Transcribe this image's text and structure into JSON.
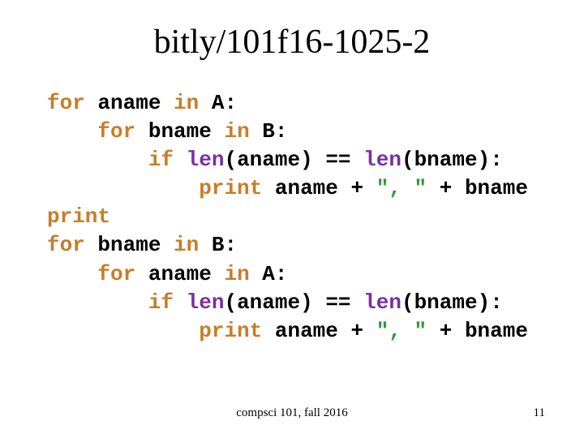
{
  "title": "bitly/101f16-1025-2",
  "footer": {
    "center": "compsci 101, fall 2016",
    "page": "11"
  },
  "code": {
    "l1": {
      "kw_for": "for",
      "var": "aname",
      "kw_in": "in",
      "seq": "A",
      "colon": ":"
    },
    "l2": {
      "kw_for": "for",
      "var": "bname",
      "kw_in": "in",
      "seq": "B",
      "colon": ":"
    },
    "l3": {
      "kw_if": "if",
      "fn1": "len",
      "arg1": "aname",
      "eq": "==",
      "fn2": "len",
      "arg2": "bname",
      "colon": ":"
    },
    "l4": {
      "kw_print": "print",
      "lhs": "aname",
      "plus1": "+",
      "str": "\", \"",
      "plus2": "+",
      "rhs": "bname"
    },
    "l5": {
      "kw_print": "print"
    },
    "l6": {
      "kw_for": "for",
      "var": "bname",
      "kw_in": "in",
      "seq": "B",
      "colon": ":"
    },
    "l7": {
      "kw_for": "for",
      "var": "aname",
      "kw_in": "in",
      "seq": "A",
      "colon": ":"
    },
    "l8": {
      "kw_if": "if",
      "fn1": "len",
      "arg1": "aname",
      "eq": "==",
      "fn2": "len",
      "arg2": "bname",
      "colon": ":"
    },
    "l9": {
      "kw_print": "print",
      "lhs": "aname",
      "plus1": "+",
      "str": "\", \"",
      "plus2": "+",
      "rhs": "bname"
    }
  }
}
